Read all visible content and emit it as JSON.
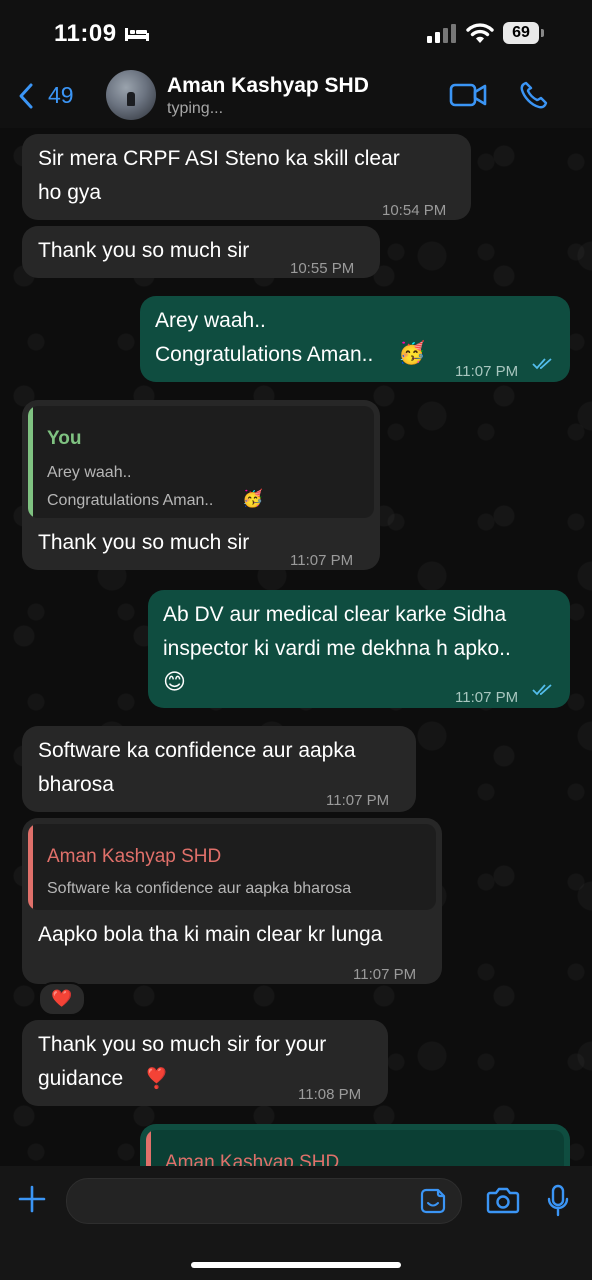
{
  "status_bar": {
    "time": "11:09",
    "battery": "69"
  },
  "header": {
    "back_count": "49",
    "contact_name": "Aman Kashyap SHD",
    "contact_status": "typing..."
  },
  "messages": [
    {
      "direction": "incoming",
      "lines": [
        "Sir mera CRPF ASI Steno ka skill clear",
        "ho gya"
      ],
      "time": "10:54 PM"
    },
    {
      "direction": "incoming",
      "lines": [
        "Thank you so much sir"
      ],
      "time": "10:55 PM"
    },
    {
      "direction": "outgoing",
      "lines": [
        "Arey waah..",
        "Congratulations Aman..",
        "🥳"
      ],
      "time": "11:07 PM"
    },
    {
      "direction": "incoming",
      "quote": {
        "author": "You",
        "lines": [
          "Arey waah..",
          "Congratulations Aman..",
          "🥳"
        ]
      },
      "lines": [
        "Thank you so much sir"
      ],
      "time": "11:07 PM"
    },
    {
      "direction": "outgoing",
      "lines": [
        "Ab DV aur medical clear karke Sidha",
        "inspector ki vardi me dekhna h apko..",
        "😊"
      ],
      "time": "11:07 PM"
    },
    {
      "direction": "incoming",
      "lines": [
        "Software ka confidence aur aapka",
        "bharosa"
      ],
      "time": "11:07 PM"
    },
    {
      "direction": "incoming",
      "quote": {
        "author": "Aman Kashyap SHD",
        "lines": [
          "Software ka confidence aur aapka bharosa"
        ]
      },
      "lines": [
        "Aapko bola tha ki main clear kr lunga"
      ],
      "time": "11:07 PM",
      "reaction": "❤️"
    },
    {
      "direction": "incoming",
      "lines": [
        "Thank you so much sir for your",
        "guidance",
        "❣️"
      ],
      "time": "11:08 PM"
    },
    {
      "direction": "outgoing",
      "quote": {
        "author": "Aman Kashyap SHD"
      }
    }
  ],
  "colors": {
    "accent_blue": "#3b95f5",
    "incoming_bubble": "#272727",
    "outgoing_bubble": "#0f4d40",
    "quote_you": "#7fc281",
    "quote_contact": "#e0706a"
  }
}
